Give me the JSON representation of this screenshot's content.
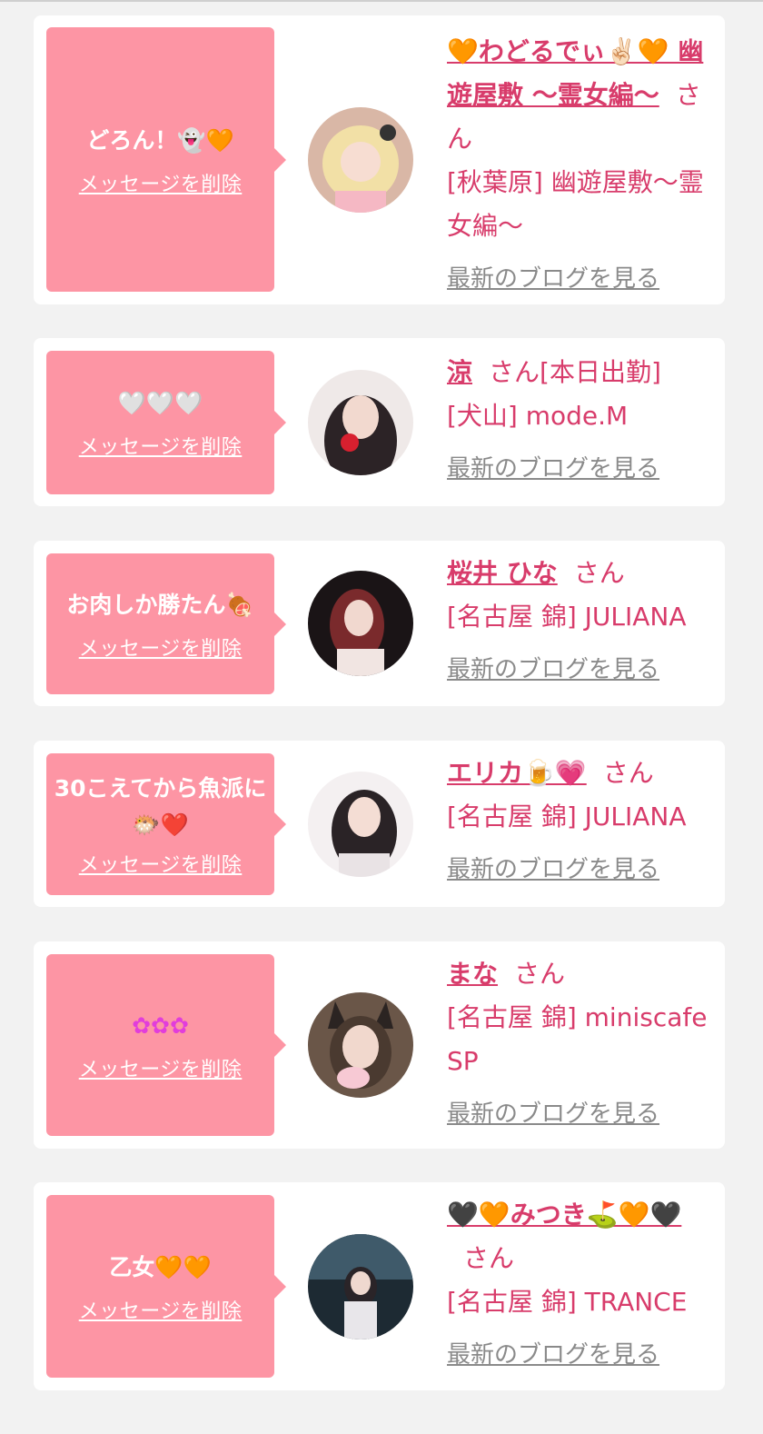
{
  "common": {
    "delete_label": "メッセージを削除",
    "blog_label": "最新のブログを見る",
    "suffix": "さん"
  },
  "colors": {
    "background": "#f2f2f2",
    "card": "#ffffff",
    "bubble": "#fd95a4",
    "accent_text": "#d83c6b",
    "link_gray": "#8a8a8a"
  },
  "items": [
    {
      "message": "どろん！👻🧡",
      "name": "🧡わどるでぃ✌🏻🧡 幽遊屋敷 〜霊女編〜",
      "status": "",
      "shop": "[秋葉原] 幽遊屋敷〜霊女編〜",
      "avatar_icon": "avatar-blonde-girl"
    },
    {
      "message": "🤍🤍🤍",
      "name": "涼",
      "status": "[本日出勤]",
      "shop": "[犬山] mode.M",
      "avatar_icon": "avatar-long-dark-hair-girl"
    },
    {
      "message": "お肉しか勝たん🍖",
      "name": "桜井 ひな",
      "status": "",
      "shop": "[名古屋 錦] JULIANA",
      "avatar_icon": "avatar-red-hair-girl"
    },
    {
      "message": "30こえてから魚派に🐡❤️",
      "name": "エリカ🍺💗",
      "status": "",
      "shop": "[名古屋 錦] JULIANA",
      "avatar_icon": "avatar-dark-hair-girl"
    },
    {
      "message": "✿✿✿",
      "name": "まな",
      "status": "",
      "shop": "[名古屋 錦] miniscafe SP",
      "avatar_icon": "avatar-cat-ears-girl"
    },
    {
      "message": "乙女🧡🧡",
      "name": "🖤🧡みつき⛳🧡🖤",
      "status": "",
      "shop": "[名古屋 錦] TRANCE",
      "avatar_icon": "avatar-night-girl"
    }
  ]
}
